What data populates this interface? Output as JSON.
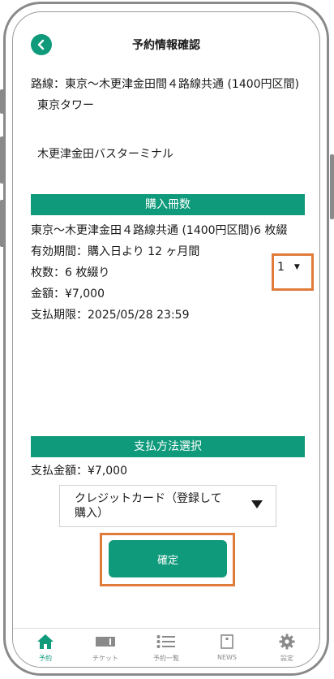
{
  "header": {
    "title": "予約情報確認"
  },
  "route": {
    "label": "路線：東京〜木更津金田間４路線共通 (1400円区間)",
    "from": "東京タワー",
    "to": "木更津金田バスターミナル"
  },
  "purchase": {
    "section_title": "購入冊数",
    "ticket_name": "東京〜木更津金田４路線共通 (1400円区間)6 枚綴",
    "validity": "有効期間：購入日より 12 ヶ月間",
    "sheets": "枚数：6 枚綴り",
    "amount": "金額：¥7,000",
    "deadline": "支払期限：2025/05/28 23:59",
    "quantity": "1"
  },
  "payment": {
    "section_title": "支払方法選択",
    "total": "支払金額：¥7,000",
    "method_line1": "クレジットカード（登録して",
    "method_line2": "購入）",
    "confirm_label": "確定"
  },
  "tabs": [
    {
      "label": "予約",
      "icon": "home-icon"
    },
    {
      "label": "チケット",
      "icon": "ticket-icon"
    },
    {
      "label": "予約一覧",
      "icon": "list-icon"
    },
    {
      "label": "NEWS",
      "icon": "news-icon"
    },
    {
      "label": "設定",
      "icon": "gear-icon"
    }
  ],
  "colors": {
    "accent": "#0f9a7b",
    "highlight": "#e07b39"
  }
}
